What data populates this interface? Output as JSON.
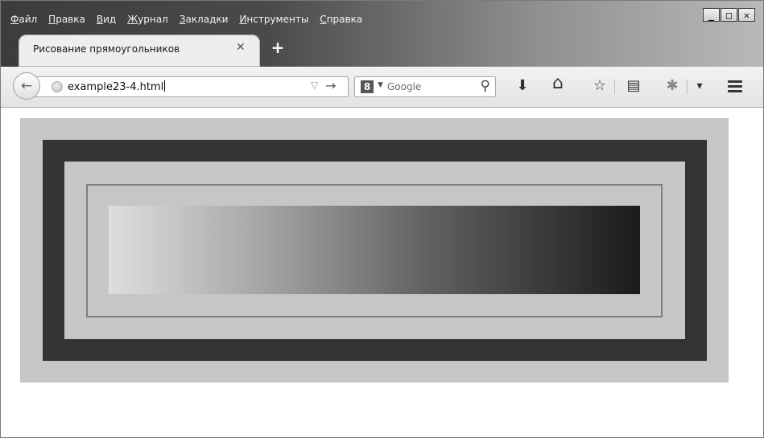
{
  "menu": {
    "items": [
      {
        "accel": "Ф",
        "rest": "айл"
      },
      {
        "accel": "П",
        "rest": "равка"
      },
      {
        "accel": "В",
        "rest": "ид"
      },
      {
        "accel": "Ж",
        "rest": "урнал"
      },
      {
        "accel": "З",
        "rest": "акладки"
      },
      {
        "accel": "И",
        "rest": "нструменты"
      },
      {
        "accel": "С",
        "rest": "правка"
      }
    ]
  },
  "window_controls": {
    "minimize": "_",
    "maximize": "□",
    "close": "✕"
  },
  "tab": {
    "title": "Рисование прямоугольников",
    "close": "✕",
    "new_tab": "+"
  },
  "navbar": {
    "back_icon": "←",
    "url": "example23-4.html",
    "url_dropdown": "▽",
    "go_icon": "→",
    "search_engine_logo": "8",
    "search_engine_drop": "▼",
    "search_placeholder": "Google",
    "search_icon": "⚲",
    "download_icon": "⬇",
    "home_icon": "⌂",
    "bookmark_star_icon": "☆",
    "bookmarks_list_icon": "▤",
    "addon_icon": "✱",
    "overflow_drop_icon": "▾"
  },
  "page": {
    "gradient_colors": {
      "start": "#dedede",
      "end": "#1b1b1b"
    },
    "rect_colors": {
      "light": "#c6c6c6",
      "dark": "#333333",
      "border": "#7f7f7f"
    }
  }
}
